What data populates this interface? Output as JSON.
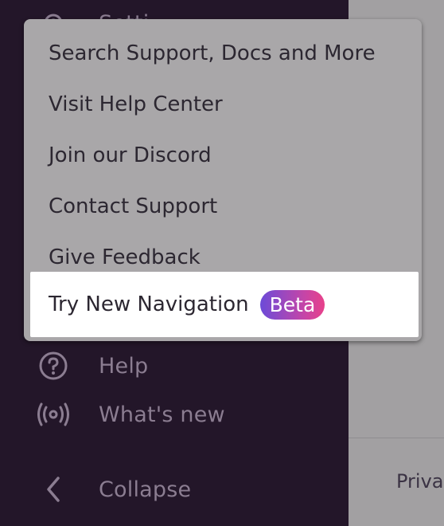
{
  "sidebar": {
    "partial_top_label": "Setti",
    "items": [
      {
        "label": "Help",
        "icon": "help-circle-icon"
      },
      {
        "label": "What's new",
        "icon": "broadcast-icon"
      },
      {
        "label": "Collapse",
        "icon": "chevron-left-icon"
      }
    ]
  },
  "menu": {
    "items": [
      {
        "label": "Search Support, Docs and More"
      },
      {
        "label": "Visit Help Center"
      },
      {
        "label": "Join our Discord"
      },
      {
        "label": "Contact Support"
      },
      {
        "label": "Give Feedback"
      },
      {
        "label": "Try New Navigation",
        "badge": "Beta"
      }
    ]
  },
  "main": {
    "footer_link": "Priva"
  },
  "colors": {
    "sidebar_bg": "#231629",
    "overlay_bg": "#a2a0a2",
    "menu_bg": "#a9a7a9",
    "sidebar_text": "#8b7d91",
    "badge_gradient_start": "#6c4bd8",
    "badge_gradient_end": "#e8418a"
  }
}
